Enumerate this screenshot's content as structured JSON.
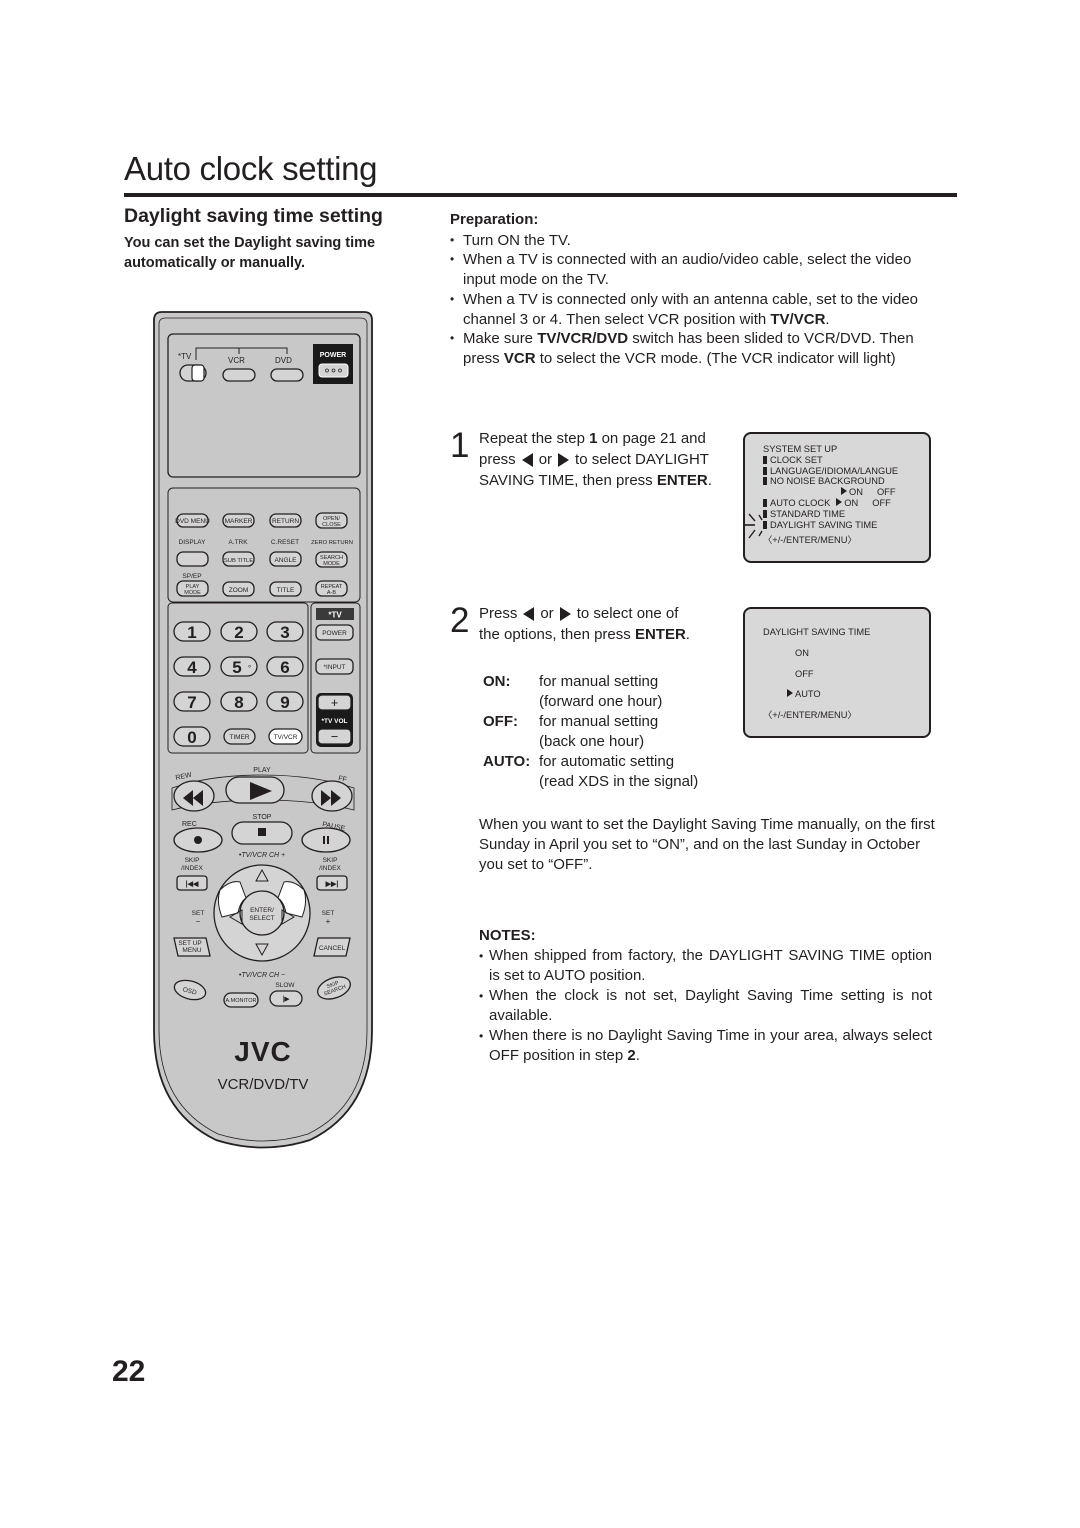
{
  "page": {
    "title": "Auto clock setting",
    "section_title": "Daylight saving time setting",
    "intro": "You can set the Daylight saving time automatically or manually.",
    "page_number": "22"
  },
  "preparation": {
    "heading": "Preparation:",
    "items": [
      {
        "text": "Turn ON the TV."
      },
      {
        "text": "When a TV is connected with an audio/video cable, select the video input mode on the TV."
      },
      {
        "pre": "When a TV is connected only with an antenna cable, set to the video channel 3 or 4. Then select VCR position with ",
        "bold": "TV/VCR",
        "post": "."
      },
      {
        "pre": "Make sure ",
        "bold": "TV/VCR/DVD",
        "mid": " switch has been slided to VCR/DVD. Then press ",
        "bold2": "VCR",
        "post": " to select the VCR mode. (The VCR indicator will light)"
      }
    ]
  },
  "steps": [
    {
      "number": "1",
      "line1_pre": "Repeat the step ",
      "line1_bold": "1",
      "line1_post": " on page 21 and",
      "line2_pre": "press",
      "line2_or": "or",
      "line2_post": "to  select DAYLIGHT",
      "line3_pre": "SAVING TIME, then press ",
      "line3_bold": "ENTER",
      "line3_post": "."
    },
    {
      "number": "2",
      "line1_pre": "Press",
      "line1_or": "or",
      "line1_post": "to select one of",
      "line2_pre": "the options, then press ",
      "line2_bold": "ENTER",
      "line2_post": "."
    }
  ],
  "options": [
    {
      "key": "ON:",
      "line1": "for manual setting",
      "line2": "(forward one hour)"
    },
    {
      "key": "OFF:",
      "line1": "for manual setting",
      "line2": "(back one hour)"
    },
    {
      "key": "AUTO:",
      "line1": "for automatic setting",
      "line2": "(read XDS in the signal)"
    }
  ],
  "osd_system_setup": {
    "title": "SYSTEM SET UP",
    "items": [
      "CLOCK SET",
      "LANGUAGE/IDIOMA/LANGUE",
      "NO NOISE BACKGROUND"
    ],
    "no_noise_on": "ON",
    "no_noise_off": "OFF",
    "auto_clock": "AUTO CLOCK",
    "auto_clock_on": "ON",
    "auto_clock_off": "OFF",
    "standard_time": "STANDARD TIME",
    "daylight_saving_time": "DAYLIGHT SAVING TIME",
    "footer": "〈+/-/ENTER/MENU〉"
  },
  "osd_daylight": {
    "title": "DAYLIGHT  SAVING  TIME",
    "options": [
      "ON",
      "OFF",
      "AUTO"
    ],
    "selected": "AUTO",
    "footer": "〈+/-/ENTER/MENU〉"
  },
  "explanation": "When you want to set the Daylight Saving Time manually, on the first Sunday in April you set to “ON”, and on the last Sunday in October you set to “OFF”.",
  "notes": {
    "heading": "NOTES:",
    "items": [
      {
        "text": "When shipped from factory, the DAYLIGHT SAVING TIME option is set to AUTO position."
      },
      {
        "text": "When the clock is not set, Daylight Saving Time setting is not available."
      },
      {
        "pre": "When there is no Daylight Saving Time in your area, always select OFF position in step ",
        "bold": "2",
        "post": "."
      }
    ]
  },
  "remote": {
    "switch_labels": {
      "tv": "*TV",
      "vcr": "VCR",
      "dvd": "DVD"
    },
    "power": "POWER",
    "row1": [
      "DVD MENU",
      "MARKER",
      "RETURN",
      "OPEN/",
      "CLOSE"
    ],
    "row2_labels": [
      "DISPLAY",
      "A.TRK",
      "C.RESET",
      "ZERO RETURN"
    ],
    "row2_buttons": [
      "SUB TITLE",
      "ANGLE",
      "SEARCH",
      "MODE"
    ],
    "row3_label": "SP/EP",
    "row3_buttons": [
      "PLAY",
      "MODE",
      "ZOOM",
      "TITLE",
      "REPEAT",
      "A-B"
    ],
    "digits": [
      "1",
      "2",
      "3",
      "4",
      "5",
      "6",
      "7",
      "8",
      "9",
      "0"
    ],
    "digit5_dot": "°",
    "timer": "TIMER",
    "tvvcr": "TV/VCR",
    "tv_header": "*TV",
    "tv_power": "POWER",
    "tv_input": "*INPUT",
    "tv_vol": "*TV VOL",
    "plus": "+",
    "minus": "−",
    "transport": {
      "rew": "REW",
      "play": "PLAY",
      "ff": "FF",
      "rec": "REC",
      "stop": "STOP",
      "pause": "PAUSE"
    },
    "skip_index": [
      "SKIP",
      "/INDEX"
    ],
    "ch_up": "•TV/VCR CH +",
    "ch_down": "•TV/VCR CH −",
    "set": "SET",
    "enter": [
      "ENTER/",
      "SELECT"
    ],
    "setup_menu": [
      "SET UP",
      "MENU"
    ],
    "cancel": "CANCEL",
    "osd": "OSD",
    "amonitor": "A.MONITOR",
    "slow": "SLOW",
    "skip_search": [
      "SKIP",
      "SEARCH"
    ],
    "brand": "JVC",
    "model": "VCR/DVD/TV"
  }
}
